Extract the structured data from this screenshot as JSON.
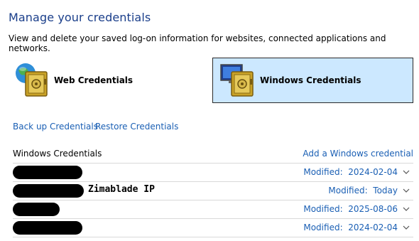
{
  "header": {
    "title": "Manage your credentials",
    "subtitle": "View and delete your saved log-on information for websites, connected applications and networks."
  },
  "tiles": {
    "web_label": "Web Credentials",
    "windows_label": "Windows Credentials",
    "selected": "windows"
  },
  "actions": {
    "backup": "Back up Credentials",
    "restore": "Restore Credentials"
  },
  "section": {
    "title": "Windows Credentials",
    "add_link": "Add a Windows credential"
  },
  "credentials": [
    {
      "name": "",
      "redacted": true,
      "modified_label": "Modified:",
      "modified_value": "2024-02-04"
    },
    {
      "name": "Zimablade IP",
      "redacted": true,
      "modified_label": "Modified:",
      "modified_value": "Today"
    },
    {
      "name": "",
      "redacted": true,
      "modified_label": "Modified:",
      "modified_value": "2025-08-06"
    },
    {
      "name": "",
      "redacted": true,
      "modified_label": "Modified:",
      "modified_value": "2024-02-04"
    }
  ],
  "colors": {
    "title": "#1a3e8a",
    "link": "#1a5fb4",
    "selected_tile_bg": "#cce8ff"
  },
  "icons": {
    "web_tile": "globe-safe-icon",
    "windows_tile": "monitor-safe-icon",
    "row_expand": "chevron-down-icon"
  }
}
